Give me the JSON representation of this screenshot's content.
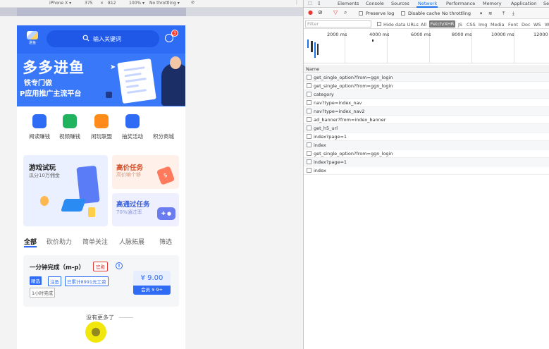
{
  "device_toolbar": {
    "device": "iPhone X ▾",
    "width": "375",
    "times": "×",
    "height": "812",
    "zoom": "100% ▾",
    "throttling": "No throttling ▾",
    "rotate_icon": "rotate-icon",
    "more_icon": "kebab-icon"
  },
  "app": {
    "logo_text": "进鱼",
    "search_placeholder": "输入关键词",
    "message_badge": "3",
    "banner": {
      "title": "多多进鱼",
      "line1": "铁专门做",
      "line2": "P应用推广主流平台"
    },
    "nav": [
      {
        "label": "阅读赚钱",
        "icon": "star-bookmark-icon",
        "color": "#2f6cf6"
      },
      {
        "label": "视频赚钱",
        "icon": "video-icon",
        "color": "#22b35e"
      },
      {
        "label": "闲玩联盟",
        "icon": "gamepad-icon",
        "color": "#ff8c1a"
      },
      {
        "label": "抽奖活动",
        "icon": "flag-icon",
        "color": "#2f6cf6"
      },
      {
        "label": "积分商城",
        "icon": "",
        "color": ""
      }
    ],
    "cards": {
      "game": {
        "title": "游戏试玩",
        "subtitle": "瓜分10万佣金"
      },
      "high": {
        "title": "高价任务",
        "subtitle": "高价嘛个够"
      },
      "pass": {
        "title": "高通过任务",
        "subtitle": "70%通过率"
      }
    },
    "tabs": [
      "全部",
      "砍价助力",
      "简单关注",
      "人脉拓展",
      "筛选"
    ],
    "task": {
      "title": "一分钟完成（m-p）",
      "badge": "官殿",
      "info_icon": "info-icon",
      "tags": [
        "精选",
        "注鱼",
        "已累计8991元工资",
        "1小时完成"
      ],
      "price": "¥ 9.00",
      "member_price": "会员 ¥ 9+"
    },
    "no_more": "没有更多了"
  },
  "devtools": {
    "tabs": [
      "Elements",
      "Console",
      "Sources",
      "Network",
      "Performance",
      "Memory",
      "Application",
      "Se"
    ],
    "active_tab": "Network",
    "toolbar": {
      "preserve_log": "Preserve log",
      "disable_cache": "Disable cache",
      "throttling": "No throttling"
    },
    "filter": {
      "placeholder": "Filter",
      "hide_data_urls": "Hide data URLs",
      "types": [
        "All",
        "Fetch/XHR",
        "JS",
        "CSS",
        "Img",
        "Media",
        "Font",
        "Doc",
        "WS",
        "W"
      ]
    },
    "timeline_ticks": [
      "2000 ms",
      "4000 ms",
      "6000 ms",
      "8000 ms",
      "10000 ms",
      "12000 ms"
    ],
    "column_header": "Name",
    "requests": [
      "get_single_option?from=ggn_login",
      "get_single_option?from=ggn_login",
      "category",
      "nav?type=index_nav",
      "nav?type=index_nav2",
      "ad_banner?from=index_banner",
      "get_h5_url",
      "index?page=1",
      "index",
      "get_single_option?from=ggn_login",
      "index?page=1",
      "index"
    ]
  }
}
